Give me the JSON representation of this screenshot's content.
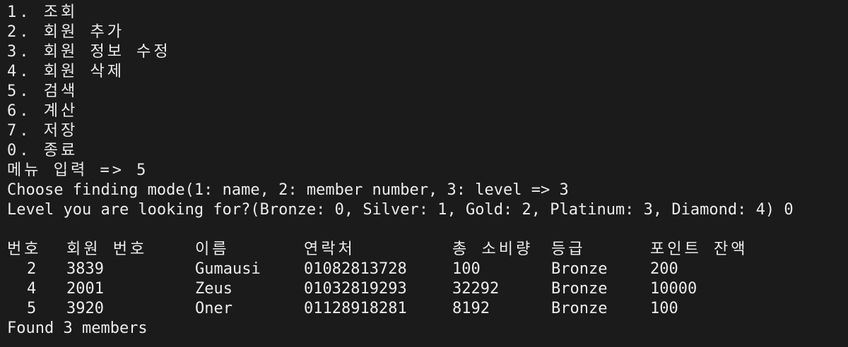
{
  "menu": [
    "1. 조회",
    "2. 회원 추가",
    "3. 회원 정보 수정",
    "4. 회원 삭제",
    "5. 검색",
    "6. 계산",
    "7. 저장",
    "0. 종료"
  ],
  "prompts": {
    "menu_input": "메뉴 입력 => 5",
    "find_mode": "Choose finding mode(1: name, 2: member number, 3: level => 3",
    "level_query": "Level you are looking for?(Bronze: 0, Silver: 1, Gold: 2, Platinum: 3, Diamond: 4) 0"
  },
  "table": {
    "headers": [
      "번호",
      "회원 번호",
      "이름",
      "연락처",
      "총 소비량",
      "등급",
      "포인트 잔액"
    ],
    "rows": [
      [
        "2",
        "3839",
        "Gumausi",
        "01082813728",
        "100",
        "Bronze",
        "200"
      ],
      [
        "4",
        "2001",
        "Zeus",
        "01032819293",
        "32292",
        "Bronze",
        "10000"
      ],
      [
        "5",
        "3920",
        "Oner",
        "01128918281",
        "8192",
        "Bronze",
        "100"
      ]
    ]
  },
  "result": "Found 3 members"
}
